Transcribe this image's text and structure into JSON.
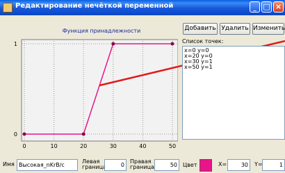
{
  "window": {
    "title": "Редактирование нечёткой переменной"
  },
  "toolbar": {
    "add_label": "Добавить",
    "delete_label": "Удалить",
    "edit_label": "Изменить"
  },
  "chart": {
    "title": "Функция принадлежности"
  },
  "points_list": {
    "label": "Список точек:",
    "items": [
      "x=0   y=0",
      "x=20   y=0",
      "x=30   y=1",
      "x=50   y=1"
    ]
  },
  "form": {
    "name_label": "Имя",
    "name_value": "Высокая_nKrB/c",
    "left_label_1": "Левая",
    "left_label_2": "граница",
    "left_value": "0",
    "right_label_1": "Правая",
    "right_label_2": "граница",
    "right_value": "50",
    "color_label": "Цвет",
    "color": "#e8158a",
    "x_label": "X=",
    "x_value": "30",
    "y_label": "Y=",
    "y_value": "1"
  },
  "chart_data": {
    "type": "line",
    "title": "Функция принадлежности",
    "x": [
      0,
      20,
      30,
      50
    ],
    "y": [
      0,
      0,
      1,
      1
    ],
    "xlim": [
      0,
      50
    ],
    "ylim": [
      0,
      1
    ],
    "x_ticks": [
      0,
      10,
      20,
      30,
      40,
      50
    ],
    "y_ticks": [
      0,
      1
    ],
    "grid": true,
    "line_color": "#e8158a",
    "marker_color": "#8b0a3c"
  }
}
